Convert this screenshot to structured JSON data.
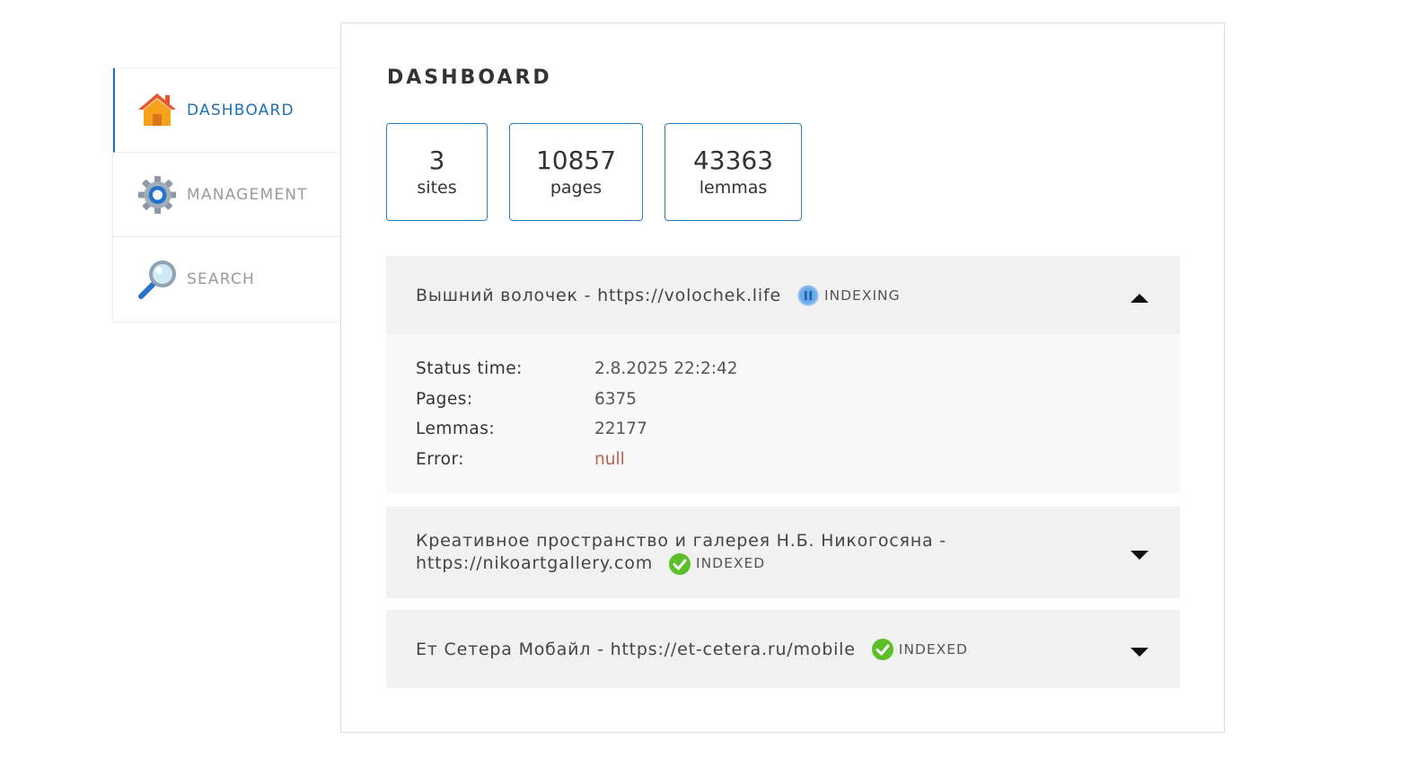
{
  "sidebar": {
    "items": [
      {
        "label": "DASHBOARD",
        "icon": "home-icon",
        "active": true
      },
      {
        "label": "MANAGEMENT",
        "icon": "gear-icon",
        "active": false
      },
      {
        "label": "SEARCH",
        "icon": "search-icon",
        "active": false
      }
    ]
  },
  "main": {
    "title": "DASHBOARD",
    "stats": [
      {
        "value": "3",
        "label": "sites"
      },
      {
        "value": "10857",
        "label": "pages"
      },
      {
        "value": "43363",
        "label": "lemmas"
      }
    ],
    "sites": [
      {
        "name": "Вышний волочек - https://volochek.life",
        "status": "INDEXING",
        "expanded": true,
        "details": {
          "status_time_label": "Status time:",
          "status_time": "2.8.2025 22:2:42",
          "pages_label": "Pages:",
          "pages": "6375",
          "lemmas_label": "Lemmas:",
          "lemmas": "22177",
          "error_label": "Error:",
          "error": "null"
        }
      },
      {
        "name": "Креативное пространство и галерея Н.Б. Никогосяна -",
        "name_line2": "https://nikoartgallery.com",
        "status": "INDEXED",
        "expanded": false
      },
      {
        "name": "Ет Сетера Мобайл - https://et-cetera.ru/mobile",
        "status": "INDEXED",
        "expanded": false
      }
    ]
  },
  "colors": {
    "accent": "#1e6fb5",
    "stat_border": "#2c7bbf",
    "error": "#c0614b",
    "indexed_green": "#5cbf2a",
    "indexing_blue": "#6aa9e8"
  }
}
